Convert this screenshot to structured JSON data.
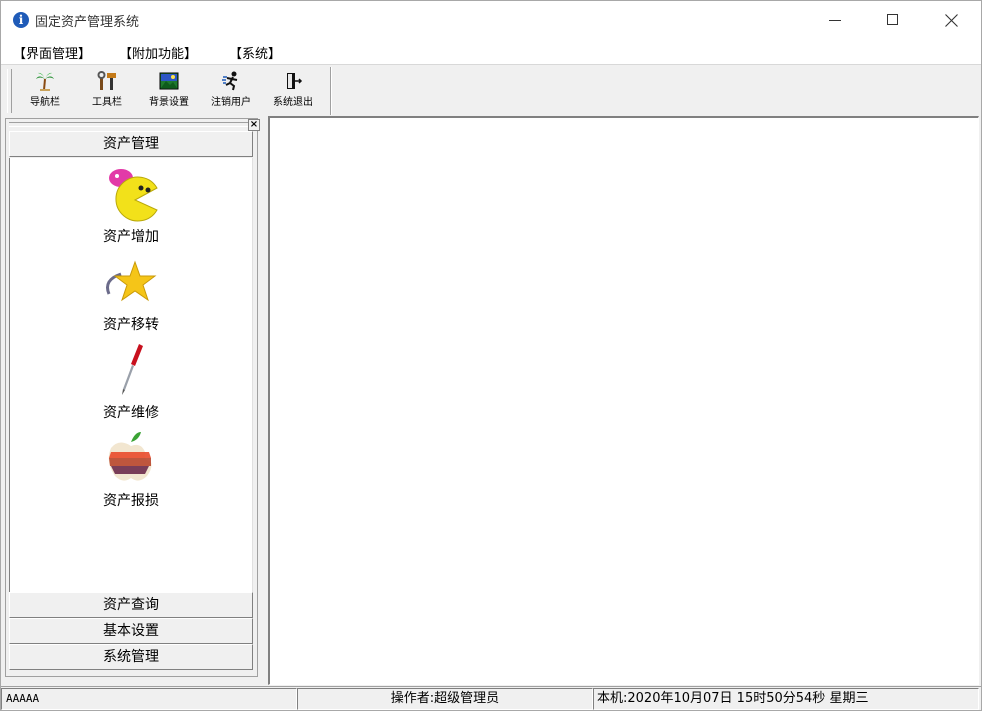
{
  "window": {
    "title": "固定资产管理系统",
    "icon": "info-icon"
  },
  "menubar": {
    "items": [
      "【界面管理】",
      "【附加功能】",
      "【系统】"
    ]
  },
  "toolbar": {
    "buttons": [
      {
        "label": "导航栏",
        "icon": "palm-tree-icon"
      },
      {
        "label": "工具栏",
        "icon": "tools-icon"
      },
      {
        "label": "背景设置",
        "icon": "picture-icon"
      },
      {
        "label": "注销用户",
        "icon": "running-man-icon"
      },
      {
        "label": "系统退出",
        "icon": "exit-door-icon"
      }
    ]
  },
  "nav": {
    "close_glyph": "×",
    "groups": [
      "资产管理",
      "资产查询",
      "基本设置",
      "系统管理"
    ],
    "items": [
      {
        "label": "资产增加",
        "icon": "pacman-icon"
      },
      {
        "label": "资产移转",
        "icon": "star-icon"
      },
      {
        "label": "资产维修",
        "icon": "screwdriver-icon"
      },
      {
        "label": "资产报损",
        "icon": "apple-icon"
      }
    ]
  },
  "statusbar": {
    "panel1": "AAAAA",
    "panel2": "操作者:超级管理员",
    "panel3": "本机:2020年10月07日 15时50分54秒 星期三"
  }
}
